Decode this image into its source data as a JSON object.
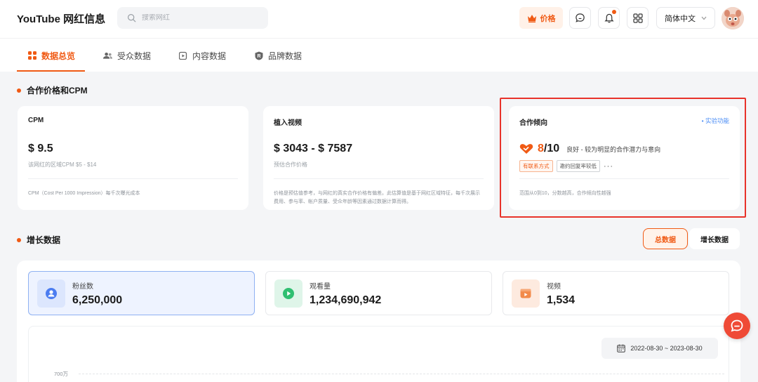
{
  "header": {
    "app_title": "YouTube 网红信息",
    "search_placeholder": "搜索网红",
    "price_label": "价格",
    "language": "简体中文"
  },
  "tabs": [
    {
      "label": "数据总览",
      "icon": "grid-icon",
      "active": true
    },
    {
      "label": "受众数据",
      "icon": "users-icon",
      "active": false
    },
    {
      "label": "内容数据",
      "icon": "video-file-icon",
      "active": false
    },
    {
      "label": "品牌数据",
      "icon": "brand-shield-icon",
      "active": false
    }
  ],
  "cooperation": {
    "section_title": "合作价格和CPM",
    "cpm": {
      "title": "CPM",
      "value": "$ 9.5",
      "sub": "该网红的区域CPM $5 - $14",
      "foot": "CPM（Cost Per 1000 Impression）每千次曝光成本"
    },
    "embedded_video": {
      "title": "植入视频",
      "value": "$ 3043 - $ 7587",
      "sub": "预估合作价格",
      "foot": "价格是预估值参考，与网红的真实合作价格有偏差。此估算值是基于网红区域特征，每千次展示费用、参与率、帐户质量、受众年龄等因素通过数据计算而得。"
    },
    "tendency": {
      "title": "合作倾向",
      "experimental": "• 实验功能",
      "score": "8",
      "score_den": "/10",
      "desc": "良好 - 较为明显的合作潜力与意向",
      "tag_contact": "有联系方式",
      "tag_reply": "邀约回复率较低",
      "more": "···",
      "foot": "范围从0到10，分数越高，合作倾向性越强"
    }
  },
  "growth": {
    "section_title": "增长数据",
    "toggle_total": "总数据",
    "toggle_growth": "增长数据",
    "metrics": [
      {
        "label": "粉丝数",
        "value": "6,250,000",
        "icon": "user-icon",
        "color": "#4b7cf0",
        "active": true
      },
      {
        "label": "观看量",
        "value": "1,234,690,942",
        "icon": "play-icon",
        "color": "#2fbf71",
        "active": false
      },
      {
        "label": "视频",
        "value": "1,534",
        "icon": "video-icon",
        "color": "#f28a4a",
        "active": false
      }
    ],
    "date_range": "2022-08-30 ~ 2023-08-30",
    "y_tick": "700万"
  },
  "colors": {
    "accent": "#f05a14",
    "highlight_border": "#e8322a",
    "chat": "#ef4a36"
  }
}
